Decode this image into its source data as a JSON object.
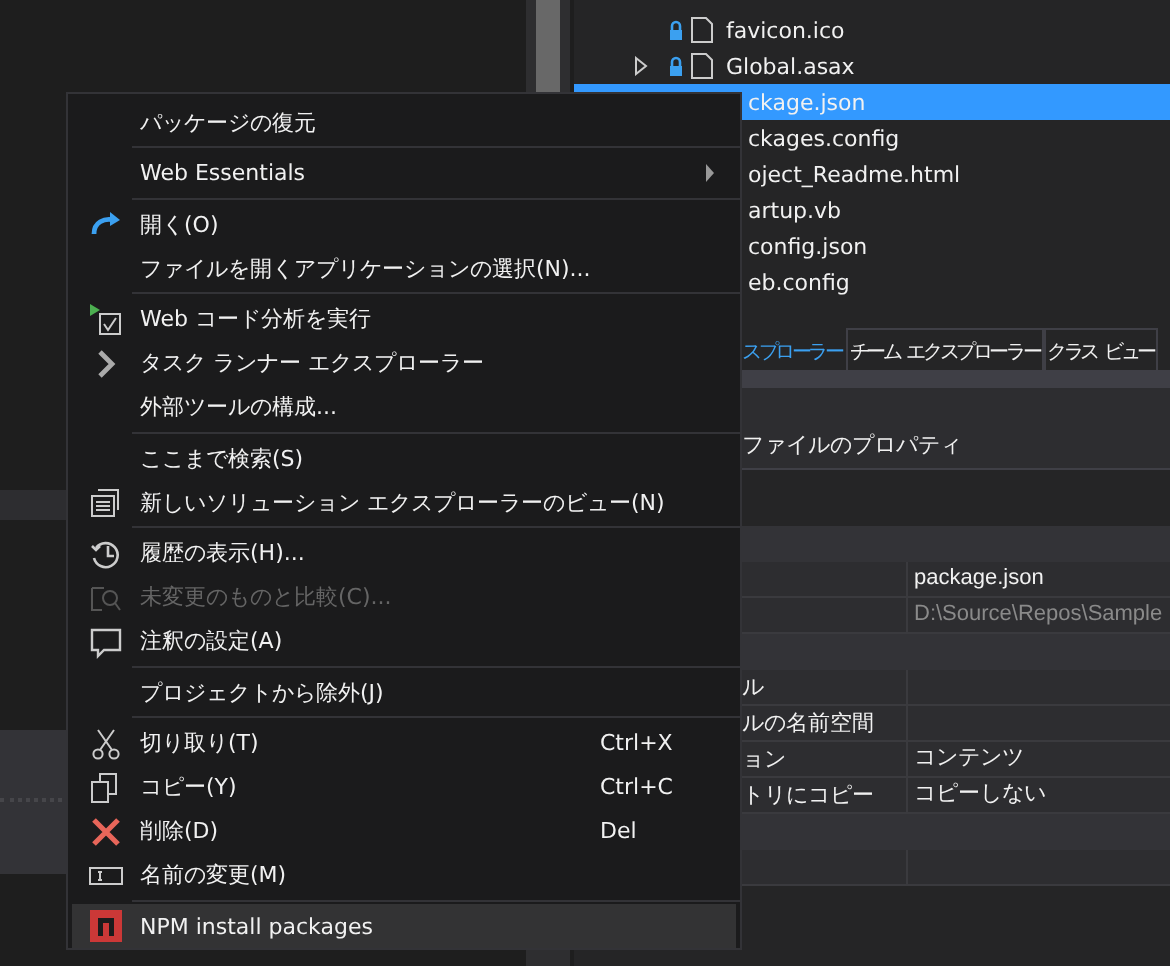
{
  "solution_explorer": {
    "items": [
      {
        "label": "favicon.ico",
        "selected": false
      },
      {
        "label": "Global.asax",
        "selected": false,
        "expanded": false
      },
      {
        "label": "ckage.json",
        "selected": true
      },
      {
        "label": "ckages.config",
        "selected": false
      },
      {
        "label": "oject_Readme.html",
        "selected": false
      },
      {
        "label": "artup.vb",
        "selected": false
      },
      {
        "label": "config.json",
        "selected": false
      },
      {
        "label": "eb.config",
        "selected": false
      }
    ]
  },
  "tabs": [
    {
      "label": "スプローラー",
      "selected": true
    },
    {
      "label": "チーム エクスプローラー",
      "selected": false
    },
    {
      "label": "クラス ビュー",
      "selected": false
    }
  ],
  "properties": {
    "title": "ファイルのプロパティ",
    "rows": [
      {
        "kind": "category"
      },
      {
        "kind": "row",
        "value": "package.json",
        "disabled": false
      },
      {
        "kind": "row",
        "value": "D:\\Source\\Repos\\Sample",
        "disabled": true
      },
      {
        "kind": "category"
      },
      {
        "kind": "row",
        "name": "ル"
      },
      {
        "kind": "row",
        "name": "ルの名前空間"
      },
      {
        "kind": "row",
        "name": "ョン",
        "value": "コンテンツ",
        "disabled": false
      },
      {
        "kind": "row",
        "name": "トリにコピー",
        "value": "コピーしない",
        "disabled": false
      },
      {
        "kind": "category"
      },
      {
        "kind": "row"
      }
    ]
  },
  "context_menu": {
    "items": [
      {
        "kind": "item",
        "label": "パッケージの復元",
        "selected": false
      },
      {
        "kind": "separator"
      },
      {
        "kind": "item",
        "label": "Web Essentials",
        "submenu": true,
        "selected": false
      },
      {
        "kind": "separator"
      },
      {
        "kind": "item",
        "label": "開く(O)",
        "selected": false
      },
      {
        "kind": "item",
        "label": "ファイルを開くアプリケーションの選択(N)...",
        "selected": false
      },
      {
        "kind": "separator"
      },
      {
        "kind": "item",
        "label": "Web コード分析を実行",
        "selected": false
      },
      {
        "kind": "item",
        "label": "タスク ランナー エクスプローラー",
        "selected": false
      },
      {
        "kind": "item",
        "label": "外部ツールの構成...",
        "selected": false
      },
      {
        "kind": "separator"
      },
      {
        "kind": "item",
        "label": "ここまで検索(S)",
        "selected": false
      },
      {
        "kind": "item",
        "label": "新しいソリューション エクスプローラーのビュー(N)",
        "selected": false
      },
      {
        "kind": "separator"
      },
      {
        "kind": "item",
        "label": "履歴の表示(H)...",
        "selected": false
      },
      {
        "kind": "item",
        "label": "未変更のものと比較(C)...",
        "disabled": true,
        "selected": false
      },
      {
        "kind": "item",
        "label": "注釈の設定(A)",
        "selected": false
      },
      {
        "kind": "separator"
      },
      {
        "kind": "item",
        "label": "プロジェクトから除外(J)",
        "selected": false
      },
      {
        "kind": "separator"
      },
      {
        "kind": "item",
        "label": "切り取り(T)",
        "shortcut": "Ctrl+X",
        "selected": false
      },
      {
        "kind": "item",
        "label": "コピー(Y)",
        "shortcut": "Ctrl+C",
        "selected": false
      },
      {
        "kind": "item",
        "label": "削除(D)",
        "shortcut": "Del",
        "selected": false
      },
      {
        "kind": "item",
        "label": "名前の変更(M)",
        "selected": false
      },
      {
        "kind": "separator"
      },
      {
        "kind": "item",
        "label": "NPM install packages",
        "selected": true
      }
    ]
  }
}
